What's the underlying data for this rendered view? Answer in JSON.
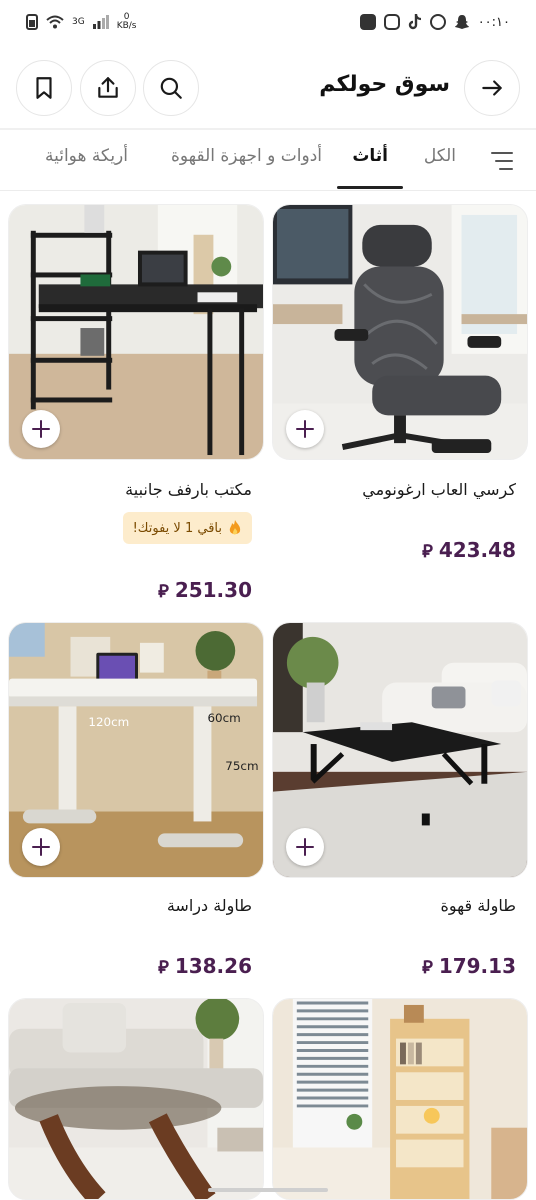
{
  "status_bar": {
    "network": "3G",
    "speed_value": "0",
    "speed_unit": "KB/s",
    "time": "٠٠:١٠"
  },
  "header": {
    "title": "سوق حولكم",
    "icons": [
      "back-arrow-icon",
      "search-icon",
      "share-icon",
      "bookmark-icon"
    ]
  },
  "tabs": [
    {
      "label": "الكل",
      "active": false
    },
    {
      "label": "أثاث",
      "active": true
    },
    {
      "label": "أدوات و اجهزة القهوة",
      "active": false
    },
    {
      "label": "أريكة هوائية",
      "active": false
    }
  ],
  "products": [
    {
      "name": "كرسي العاب ارغونومي",
      "price": "423.48",
      "currency_symbol": "⃁",
      "badge": ""
    },
    {
      "name": "مكتب بارفف جانبية",
      "price": "251.30",
      "currency_symbol": "⃁",
      "badge": "باقي 1 لا يفوتك!"
    },
    {
      "name": "طاولة قهوة",
      "price": "179.13",
      "currency_symbol": "⃁",
      "badge": ""
    },
    {
      "name": "طاولة دراسة",
      "price": "138.26",
      "currency_symbol": "⃁",
      "badge": ""
    },
    {
      "name": "",
      "price": "",
      "currency_symbol": "",
      "badge": ""
    },
    {
      "name": "",
      "price": "",
      "currency_symbol": "",
      "badge": ""
    }
  ],
  "image_labels": {
    "desk_width": "120cm",
    "desk_depth": "60cm",
    "desk_height": "75cm"
  },
  "colors": {
    "price": "#4a1f50",
    "badge_bg": "#fdeccc",
    "active_tab": "#111111",
    "inactive_tab": "#777777"
  }
}
